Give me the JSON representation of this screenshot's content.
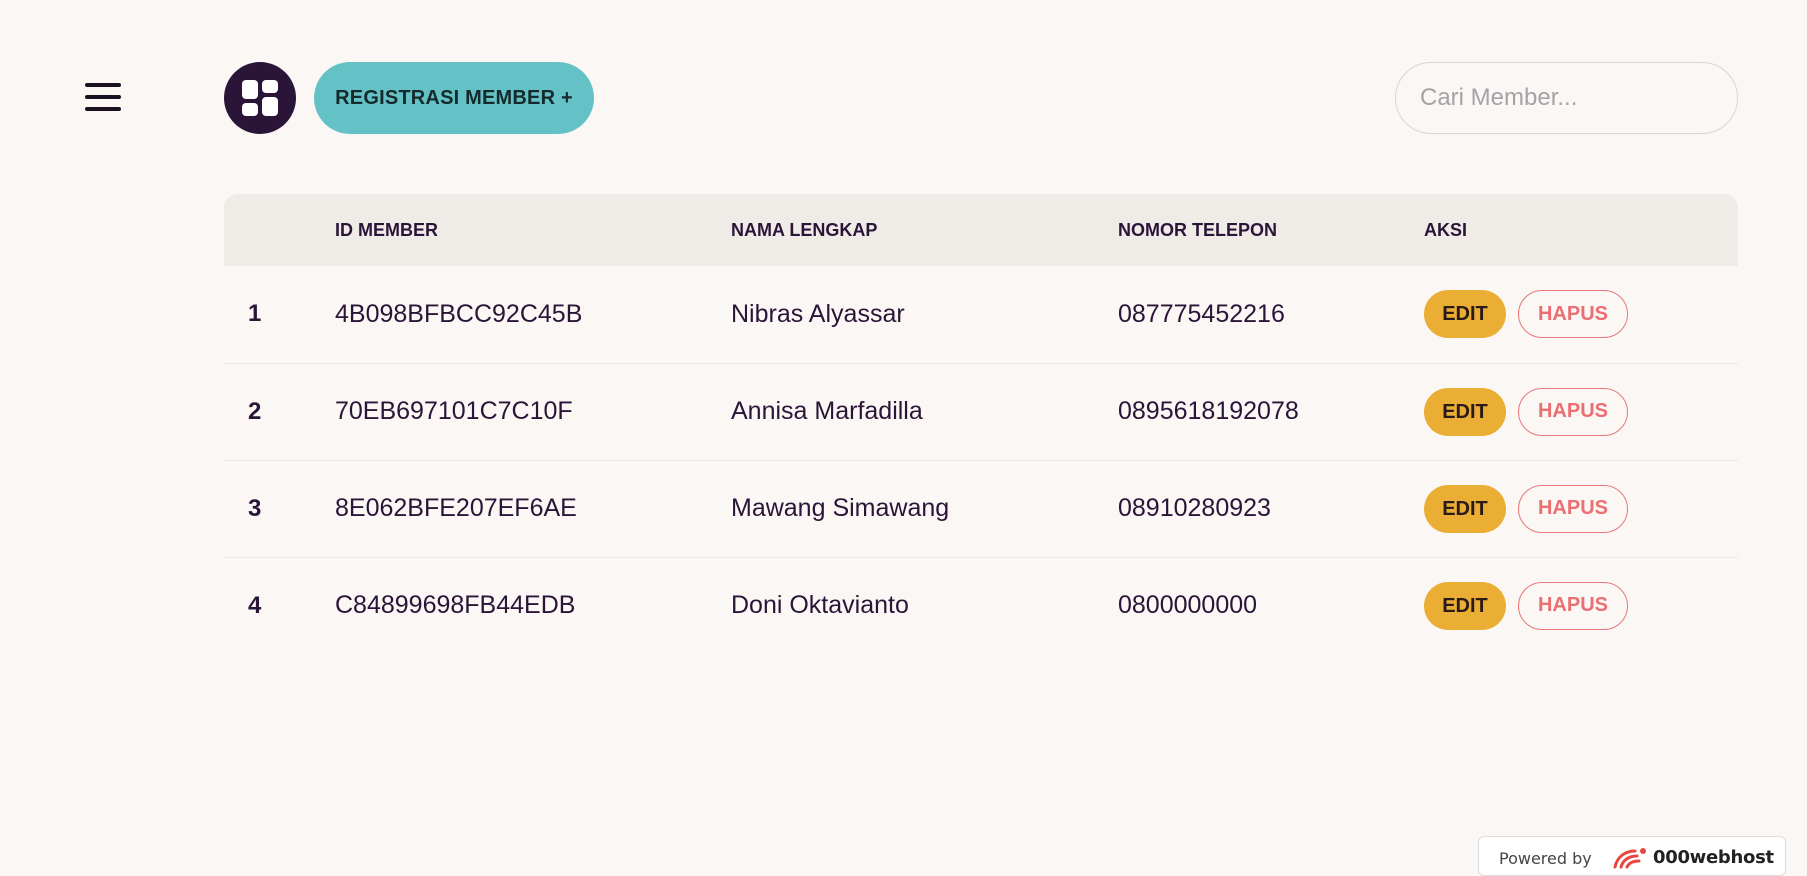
{
  "toolbar": {
    "register_label": "REGISTRASI MEMBER +",
    "search_placeholder": "Cari Member..."
  },
  "table": {
    "headers": [
      "",
      "ID MEMBER",
      "NAMA LENGKAP",
      "NOMOR TELEPON",
      "AKSI"
    ],
    "rows": [
      {
        "no": "1",
        "id": "4B098BFBCC92C45B",
        "name": "Nibras Alyassar",
        "phone": "087775452216",
        "edit": "EDIT",
        "delete": "HAPUS"
      },
      {
        "no": "2",
        "id": "70EB697101C7C10F",
        "name": "Annisa Marfadilla",
        "phone": "0895618192078",
        "edit": "EDIT",
        "delete": "HAPUS"
      },
      {
        "no": "3",
        "id": "8E062BFE207EF6AE",
        "name": "Mawang Simawang",
        "phone": "08910280923",
        "edit": "EDIT",
        "delete": "HAPUS"
      },
      {
        "no": "4",
        "id": "C84899698FB44EDB",
        "name": "Doni Oktavianto",
        "phone": "0800000000",
        "edit": "EDIT",
        "delete": "HAPUS"
      }
    ]
  },
  "footer": {
    "powered_by": "Powered by",
    "brand": "000webhost"
  },
  "icons": {
    "menu": "hamburger-menu-icon",
    "dashboard": "dashboard-grid-icon",
    "brand_logo": "000webhost-logo-icon"
  },
  "colors": {
    "background": "#faf7f4",
    "primary_dark": "#2a1538",
    "register_button": "#64c2c6",
    "edit_button": "#ebae35",
    "delete_button": "#ea6f72",
    "table_header": "#efebe7"
  }
}
